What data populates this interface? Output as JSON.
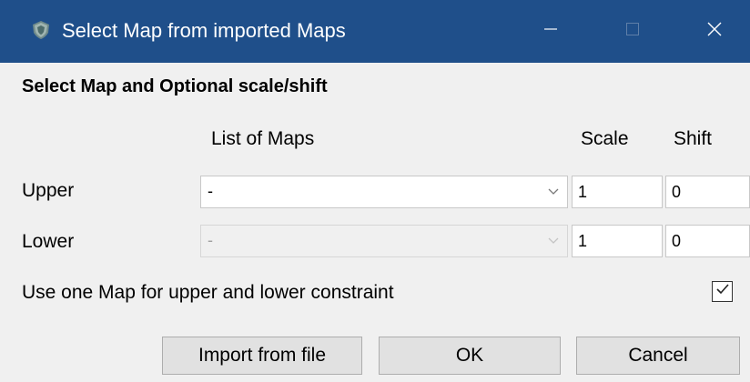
{
  "window": {
    "title": "Select Map from imported Maps",
    "icon": "app-shield-icon",
    "titlebar_color": "#1f4f8a"
  },
  "section": {
    "title": "Select Map and Optional scale/shift"
  },
  "columns": {
    "maps": "List of Maps",
    "scale": "Scale",
    "shift": "Shift"
  },
  "rows": [
    {
      "label": "Upper",
      "map_value": "-",
      "map_enabled": true,
      "scale": "1",
      "shift": "0"
    },
    {
      "label": "Lower",
      "map_value": "-",
      "map_enabled": false,
      "scale": "1",
      "shift": "0"
    }
  ],
  "option": {
    "label": "Use one Map for upper and lower constraint",
    "checked": true
  },
  "buttons": {
    "import": "Import from file",
    "ok": "OK",
    "cancel": "Cancel"
  }
}
